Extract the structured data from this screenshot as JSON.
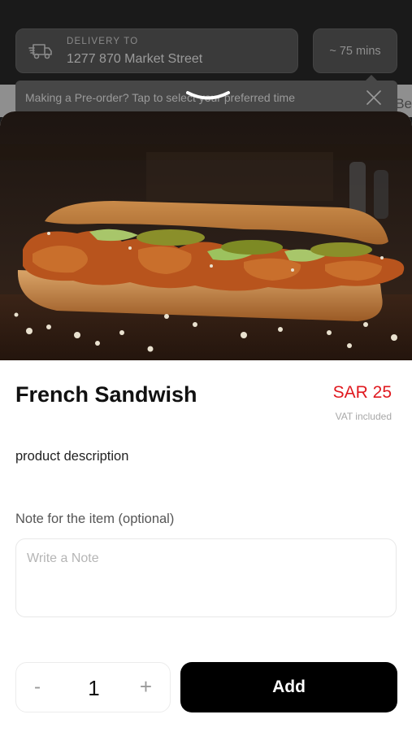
{
  "header": {
    "delivery_label": "DELIVERY TO",
    "address": "1277 870 Market Street",
    "eta": "~ 75 mins",
    "preorder_message": "Making a Pre-order? Tap to select your preferred time",
    "partial_text": "Be"
  },
  "product": {
    "name": "French Sandwish",
    "price": "SAR 25",
    "vat_note": "VAT included",
    "description": "product description"
  },
  "note": {
    "label": "Note for the item (optional)",
    "placeholder": "Write a Note",
    "value": ""
  },
  "quantity": {
    "minus": "-",
    "count": "1",
    "plus": "+"
  },
  "actions": {
    "add_label": "Add"
  },
  "colors": {
    "price": "#e0191f",
    "add_button": "#000000"
  },
  "icons": {
    "delivery": "delivery-truck-icon",
    "close": "close-icon"
  }
}
